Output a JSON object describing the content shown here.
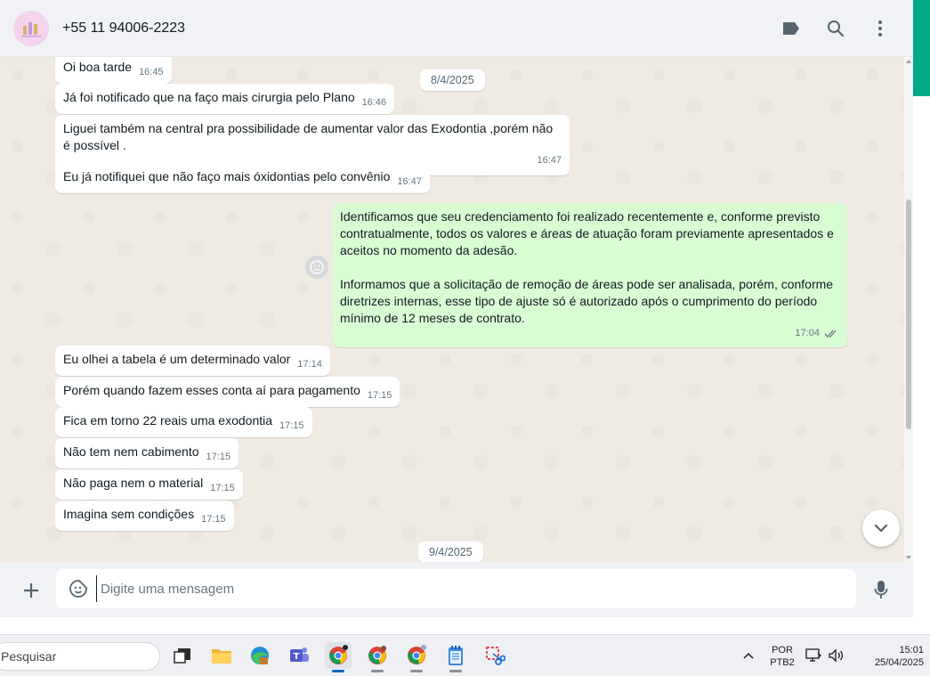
{
  "header": {
    "contact_name": "+55 11 94006-2223",
    "icons": [
      "label-icon",
      "search-icon",
      "more-options-icon"
    ]
  },
  "chat": {
    "date_separators": [
      "8/4/2025",
      "9/4/2025"
    ],
    "messages": [
      {
        "dir": "in",
        "text": "Oi boa tarde",
        "time": "16:45"
      },
      {
        "dir": "in",
        "text": "Já foi notificado que na faço mais cirurgia pelo Plano",
        "time": "16:46"
      },
      {
        "dir": "in",
        "text": "Liguei também na central pra possibilidade de aumentar valor das Exodontia ,porém não é possível .",
        "time": "16:47"
      },
      {
        "dir": "in",
        "text": "Eu já notifiquei que não faço mais óxidontias pelo convênio",
        "time": "16:47"
      },
      {
        "dir": "out",
        "paragraphs": [
          "Identificamos que seu credenciamento foi realizado recentemente e, conforme previsto contratualmente, todos os valores e áreas de atuação foram previamente apresentados e aceitos no momento da adesão.",
          "Informamos que a solicitação de remoção de áreas pode ser analisada, porém, conforme diretrizes internas, esse tipo de ajuste só é autorizado após o cumprimento do período mínimo de 12 meses de contrato."
        ],
        "time": "17:04",
        "status": "read"
      },
      {
        "dir": "in",
        "text": "Eu olhei a tabela é um determinado valor",
        "time": "17:14"
      },
      {
        "dir": "in",
        "text": "Porém quando fazem esses conta aí para pagamento",
        "time": "17:15"
      },
      {
        "dir": "in",
        "text": "Fica em torno 22 reais uma exodontia",
        "time": "17:15"
      },
      {
        "dir": "in",
        "text": "Não tem nem cabimento",
        "time": "17:15"
      },
      {
        "dir": "in",
        "text": "Não paga nem o material",
        "time": "17:15"
      },
      {
        "dir": "in",
        "text": "Imagina sem condições",
        "time": "17:15"
      }
    ]
  },
  "composer": {
    "placeholder": "Digite uma mensagem"
  },
  "taskbar": {
    "search_placeholder": "Pesquisar",
    "language_line1": "POR",
    "language_line2": "PTB2",
    "time": "15:01",
    "date": "25/04/2025"
  },
  "colors": {
    "incoming_bubble": "#ffffff",
    "outgoing_bubble": "#d9fdd3",
    "chat_background": "#efeae2",
    "accent": "#00a884",
    "read_ticks": "#667781"
  }
}
